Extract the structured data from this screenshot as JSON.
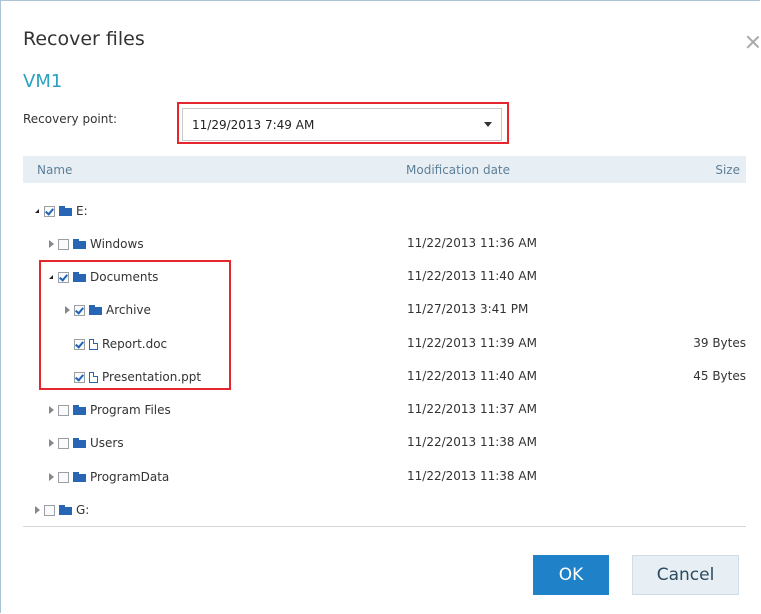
{
  "dialog": {
    "title": "Recover files",
    "vm_name": "VM1",
    "recovery_point_label": "Recovery point:",
    "recovery_point_value": "11/29/2013 7:49 AM",
    "colors": {
      "accent": "#2aa1c0",
      "primary_button": "#1f82c9",
      "highlight": "#e5262d",
      "header_bg": "#e8eff4"
    }
  },
  "table": {
    "columns": {
      "name": "Name",
      "date": "Modification date",
      "size": "Size"
    },
    "rows": [
      {
        "name": "E:",
        "date": "",
        "size": "",
        "type": "folder",
        "checked": true,
        "expander": "expanded"
      },
      {
        "name": "Windows",
        "date": "11/22/2013 11:36 AM",
        "size": "",
        "type": "folder",
        "checked": false,
        "expander": "collapsed"
      },
      {
        "name": "Documents",
        "date": "11/22/2013 11:40 AM",
        "size": "",
        "type": "folder",
        "checked": true,
        "expander": "expanded"
      },
      {
        "name": "Archive",
        "date": "11/27/2013 3:41 PM",
        "size": "",
        "type": "folder",
        "checked": true,
        "expander": "collapsed"
      },
      {
        "name": "Report.doc",
        "date": "11/22/2013 11:39 AM",
        "size": "39 Bytes",
        "type": "file",
        "checked": true,
        "expander": "none"
      },
      {
        "name": "Presentation.ppt",
        "date": "11/22/2013 11:40 AM",
        "size": "45 Bytes",
        "type": "file",
        "checked": true,
        "expander": "none"
      },
      {
        "name": "Program Files",
        "date": "11/22/2013 11:37 AM",
        "size": "",
        "type": "folder",
        "checked": false,
        "expander": "collapsed"
      },
      {
        "name": "Users",
        "date": "11/22/2013 11:38 AM",
        "size": "",
        "type": "folder",
        "checked": false,
        "expander": "collapsed"
      },
      {
        "name": "ProgramData",
        "date": "11/22/2013 11:38 AM",
        "size": "",
        "type": "folder",
        "checked": false,
        "expander": "collapsed"
      },
      {
        "name": "G:",
        "date": "",
        "size": "",
        "type": "folder",
        "checked": false,
        "expander": "collapsed"
      }
    ]
  },
  "buttons": {
    "ok": "OK",
    "cancel": "Cancel"
  }
}
